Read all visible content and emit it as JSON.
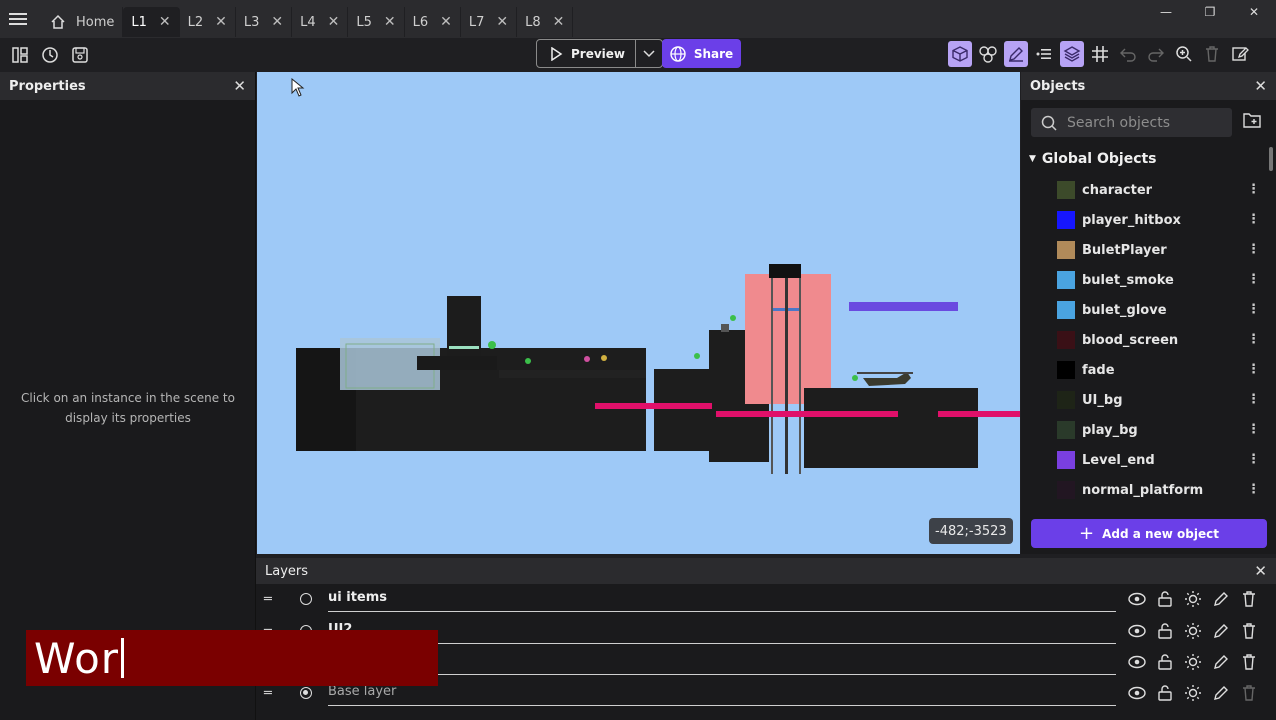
{
  "tabs": {
    "home": "Home",
    "levels": [
      "L1",
      "L2",
      "L3",
      "L4",
      "L5",
      "L6",
      "L7",
      "L8"
    ],
    "active": "L1"
  },
  "toolbar": {
    "preview_label": "Preview",
    "share_label": "Share",
    "accent_color": "#6b3fe8"
  },
  "properties": {
    "title": "Properties",
    "hint": "Click on an instance in the scene to display its properties"
  },
  "scene": {
    "coords": "-482;-3523",
    "background": "#9ec9f7"
  },
  "objects": {
    "title": "Objects",
    "search_placeholder": "Search objects",
    "folder": "Global Objects",
    "items": [
      {
        "name": "character",
        "color": "#3c4a2a"
      },
      {
        "name": "player_hitbox",
        "color": "#1616ff"
      },
      {
        "name": "BuletPlayer",
        "color": "#b08a5a"
      },
      {
        "name": "bulet_smoke",
        "color": "#4aa3e0"
      },
      {
        "name": "bulet_glove",
        "color": "#4aa3e0"
      },
      {
        "name": "blood_screen",
        "color": "#3a1016"
      },
      {
        "name": "fade",
        "color": "#000000"
      },
      {
        "name": "UI_bg",
        "color": "#1e2417"
      },
      {
        "name": "play_bg",
        "color": "#2a3a2a"
      },
      {
        "name": "Level_end",
        "color": "#7a3fe0"
      },
      {
        "name": "normal_platform",
        "color": "#221622"
      }
    ],
    "add_label": "Add a new object"
  },
  "layers": {
    "title": "Layers",
    "items": [
      {
        "name": "ui items",
        "selected": false
      },
      {
        "name": "UI2",
        "selected": false
      },
      {
        "name": "",
        "selected": false
      },
      {
        "name": "Base layer",
        "selected": true
      }
    ]
  },
  "caption": {
    "text": "Wor"
  }
}
